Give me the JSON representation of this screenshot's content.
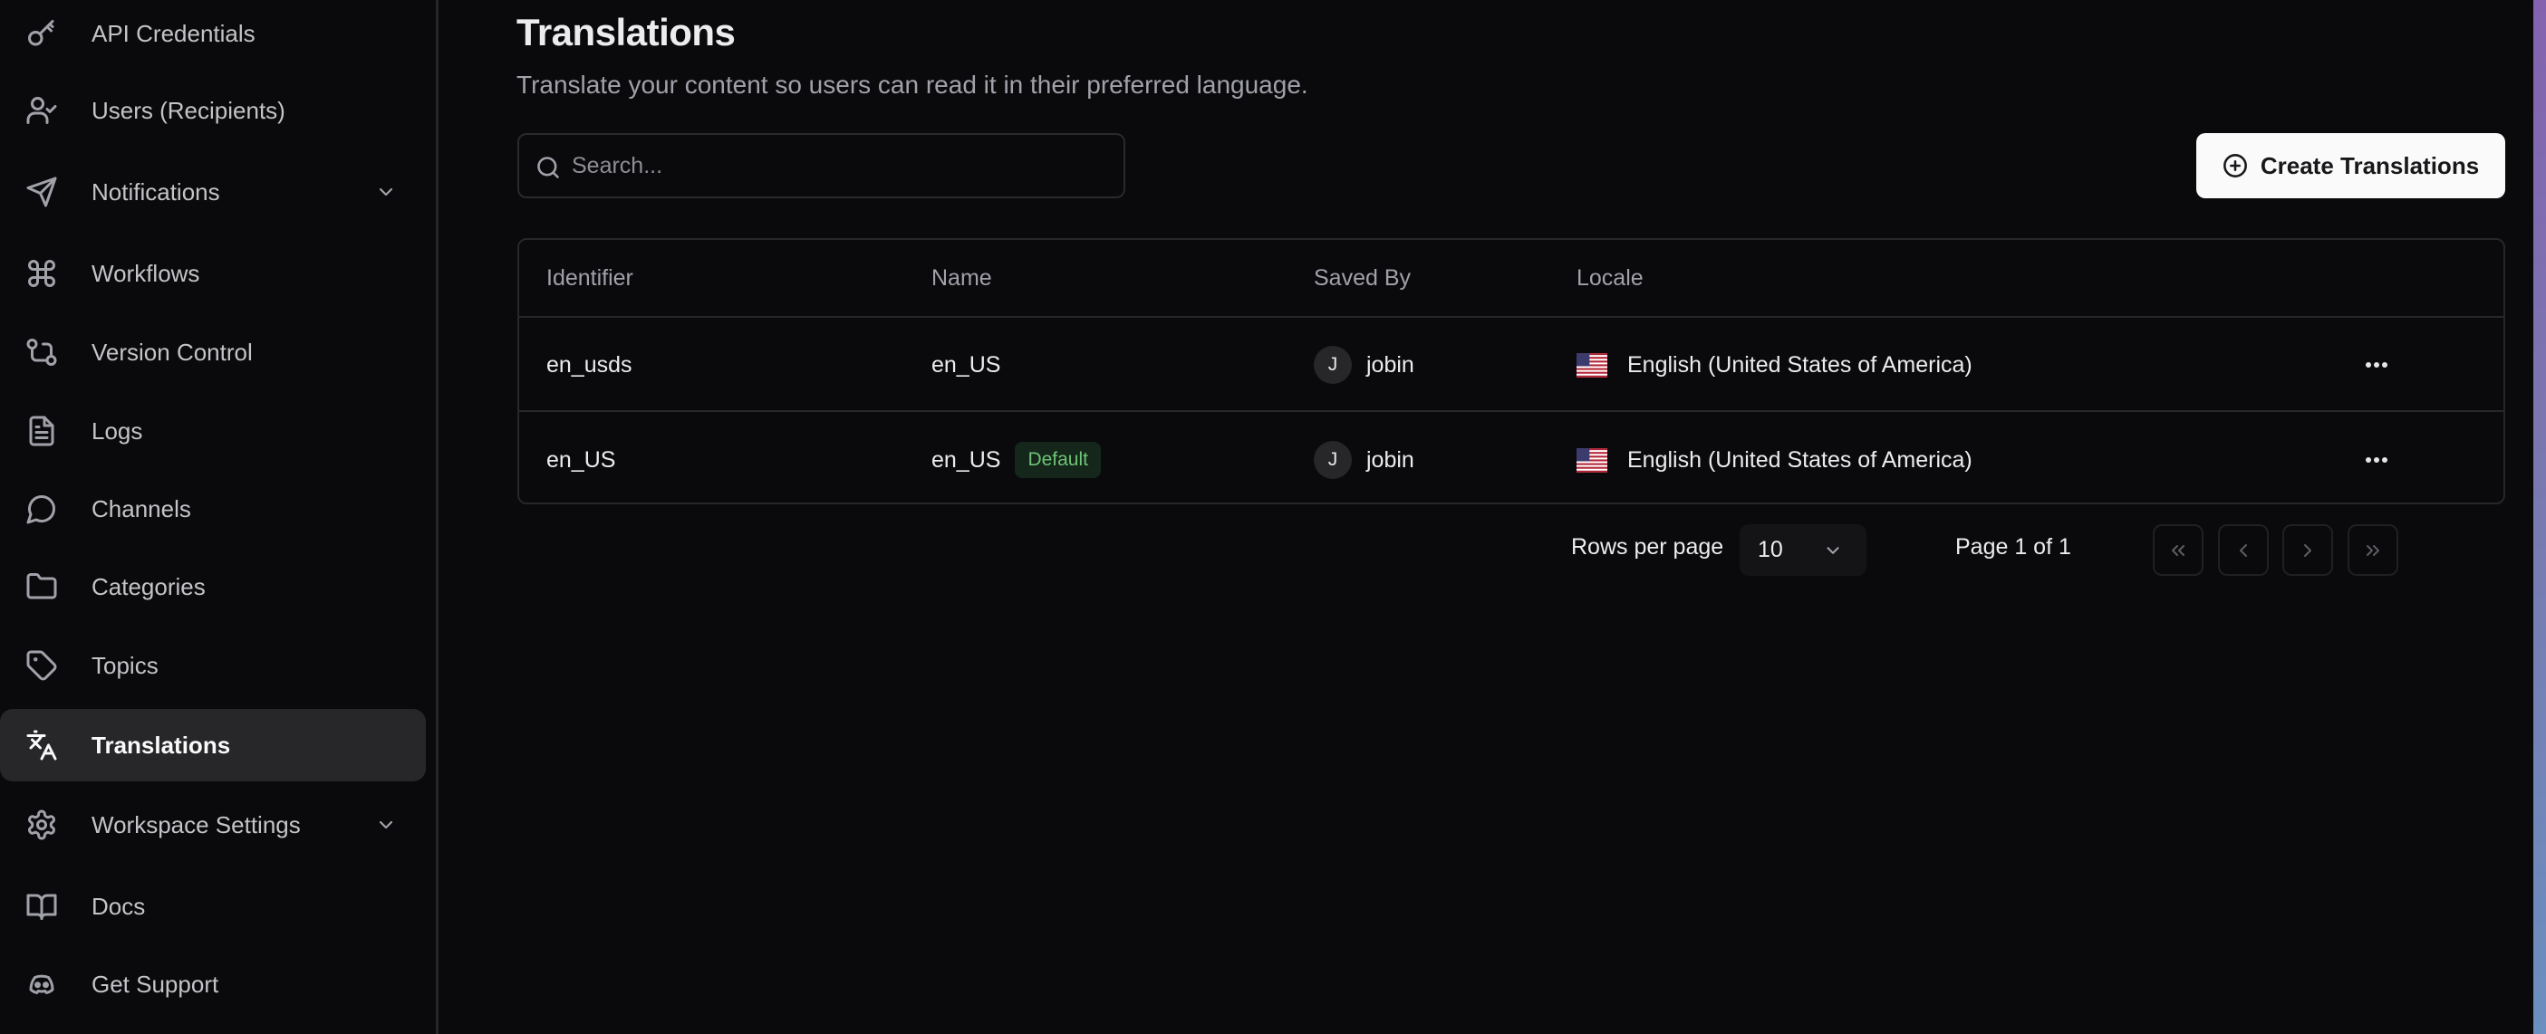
{
  "sidebar": {
    "items": [
      {
        "label": "API Credentials",
        "icon": "key-icon",
        "active": false,
        "expandable": false
      },
      {
        "label": "Users (Recipients)",
        "icon": "user-check-icon",
        "active": false,
        "expandable": false
      },
      {
        "label": "Notifications",
        "icon": "send-icon",
        "active": false,
        "expandable": true
      },
      {
        "label": "Workflows",
        "icon": "command-icon",
        "active": false,
        "expandable": false
      },
      {
        "label": "Version Control",
        "icon": "git-compare-icon",
        "active": false,
        "expandable": false
      },
      {
        "label": "Logs",
        "icon": "file-text-icon",
        "active": false,
        "expandable": false
      },
      {
        "label": "Channels",
        "icon": "message-circle-icon",
        "active": false,
        "expandable": false
      },
      {
        "label": "Categories",
        "icon": "folder-icon",
        "active": false,
        "expandable": false
      },
      {
        "label": "Topics",
        "icon": "tag-icon",
        "active": false,
        "expandable": false
      },
      {
        "label": "Translations",
        "icon": "languages-icon",
        "active": true,
        "expandable": false
      },
      {
        "label": "Workspace Settings",
        "icon": "settings-icon",
        "active": false,
        "expandable": true
      },
      {
        "label": "Docs",
        "icon": "book-open-icon",
        "active": false,
        "expandable": false
      },
      {
        "label": "Get Support",
        "icon": "discord-icon",
        "active": false,
        "expandable": false
      }
    ]
  },
  "page": {
    "title": "Translations",
    "subtitle": "Translate your content so users can read it in their preferred language."
  },
  "search": {
    "placeholder": "Search...",
    "value": ""
  },
  "create_button": {
    "label": "Create Translations",
    "icon": "plus-circle-icon"
  },
  "table": {
    "columns": [
      "Identifier",
      "Name",
      "Saved By",
      "Locale"
    ],
    "rows": [
      {
        "identifier": "en_usds",
        "name": "en_US",
        "badge": null,
        "saved_by": "jobin",
        "avatar_initial": "J",
        "locale": "English (United States of America)",
        "flag": "us-flag-icon"
      },
      {
        "identifier": "en_US",
        "name": "en_US",
        "badge": "Default",
        "saved_by": "jobin",
        "avatar_initial": "J",
        "locale": "English (United States of America)",
        "flag": "us-flag-icon"
      }
    ]
  },
  "pagination": {
    "rows_per_page_label": "Rows per page",
    "rows_per_page_value": "10",
    "page_label": "Page 1 of 1",
    "current_page": 1,
    "total_pages": 1
  },
  "colors": {
    "background": "#0a0a0c",
    "active_nav_bg": "#27272a",
    "badge_bg": "#14271a",
    "badge_text": "#6fc276",
    "primary_button_bg": "#fafafa"
  }
}
